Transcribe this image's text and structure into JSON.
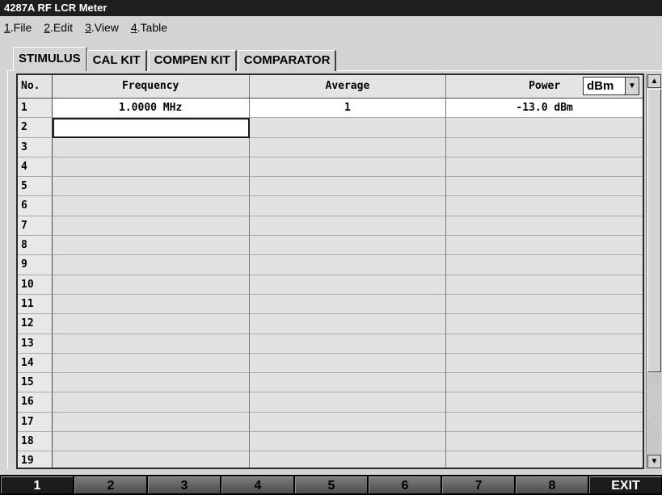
{
  "window": {
    "title": "4287A RF LCR Meter"
  },
  "menu": [
    {
      "key": "1",
      "label": ".File"
    },
    {
      "key": "2",
      "label": ".Edit"
    },
    {
      "key": "3",
      "label": ".View"
    },
    {
      "key": "4",
      "label": ".Table"
    }
  ],
  "tabs": [
    "STIMULUS",
    "CAL KIT",
    "COMPEN KIT",
    "COMPARATOR"
  ],
  "active_tab": "STIMULUS",
  "table": {
    "headers": {
      "no": "No.",
      "frequency": "Frequency",
      "average": "Average",
      "power": "Power"
    },
    "power_unit": {
      "selected": "dBm",
      "icon": "dropdown-arrow-icon"
    },
    "rows": [
      {
        "no": "1",
        "frequency": "1.0000 MHz",
        "average": "1",
        "power": "-13.0 dBm"
      },
      {
        "no": "2",
        "frequency": "",
        "average": "",
        "power": ""
      },
      {
        "no": "3",
        "frequency": "",
        "average": "",
        "power": ""
      },
      {
        "no": "4",
        "frequency": "",
        "average": "",
        "power": ""
      },
      {
        "no": "5",
        "frequency": "",
        "average": "",
        "power": ""
      },
      {
        "no": "6",
        "frequency": "",
        "average": "",
        "power": ""
      },
      {
        "no": "7",
        "frequency": "",
        "average": "",
        "power": ""
      },
      {
        "no": "8",
        "frequency": "",
        "average": "",
        "power": ""
      },
      {
        "no": "9",
        "frequency": "",
        "average": "",
        "power": ""
      },
      {
        "no": "10",
        "frequency": "",
        "average": "",
        "power": ""
      },
      {
        "no": "11",
        "frequency": "",
        "average": "",
        "power": ""
      },
      {
        "no": "12",
        "frequency": "",
        "average": "",
        "power": ""
      },
      {
        "no": "13",
        "frequency": "",
        "average": "",
        "power": ""
      },
      {
        "no": "14",
        "frequency": "",
        "average": "",
        "power": ""
      },
      {
        "no": "15",
        "frequency": "",
        "average": "",
        "power": ""
      },
      {
        "no": "16",
        "frequency": "",
        "average": "",
        "power": ""
      },
      {
        "no": "17",
        "frequency": "",
        "average": "",
        "power": ""
      },
      {
        "no": "18",
        "frequency": "",
        "average": "",
        "power": ""
      },
      {
        "no": "19",
        "frequency": "",
        "average": "",
        "power": ""
      }
    ],
    "selected_cell": {
      "row": 2,
      "column": "frequency"
    }
  },
  "scrollbar": {
    "up_icon": "scroll-up-arrow-icon",
    "down_icon": "scroll-down-arrow-icon"
  },
  "softkeys": [
    "1",
    "2",
    "3",
    "4",
    "5",
    "6",
    "7",
    "8",
    "EXIT"
  ]
}
